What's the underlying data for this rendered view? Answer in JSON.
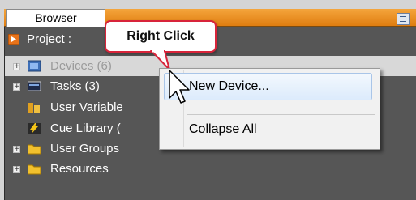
{
  "browser": {
    "tab_label": "Browser",
    "project_label": "Project :"
  },
  "tree": [
    {
      "label": "Devices (6)",
      "icon": "devices-icon",
      "expandable": true,
      "highlighted": true
    },
    {
      "label": "Tasks (3)",
      "icon": "tasks-icon",
      "expandable": true
    },
    {
      "label": "User Variable",
      "icon": "user-variables-icon",
      "expandable": false
    },
    {
      "label": "Cue Library (",
      "icon": "cue-library-icon",
      "expandable": false
    },
    {
      "label": "User Groups",
      "icon": "folder-icon",
      "expandable": true
    },
    {
      "label": "Resources",
      "icon": "folder-icon",
      "expandable": true
    }
  ],
  "callout": {
    "text": "Right Click",
    "border_color": "#d8243a"
  },
  "context_menu": {
    "items": [
      {
        "label": "New Device...",
        "hovered": true
      },
      {
        "label": "Collapse All",
        "hovered": false
      }
    ]
  },
  "colors": {
    "tab_bar": "#f09530",
    "panel": "#565656",
    "text": "#ffffff",
    "menu_hover": "#dcebfc"
  }
}
